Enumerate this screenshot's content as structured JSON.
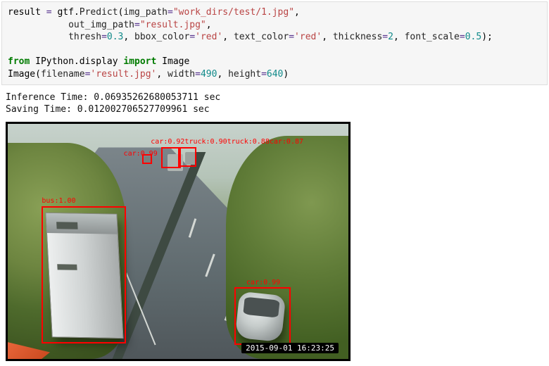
{
  "code": {
    "result_var": "result",
    "gtf": "gtf",
    "predict": "Predict",
    "img_path_key": "img_path",
    "img_path_val": "\"work_dirs/test/1.jpg\"",
    "out_img_path_key": "out_img_path",
    "out_img_path_val": "\"result.jpg\"",
    "thresh_key": "thresh",
    "thresh_val": "0.3",
    "bbox_color_key": "bbox_color",
    "bbox_color_val": "'red'",
    "text_color_key": "text_color",
    "text_color_val": "'red'",
    "thickness_key": "thickness",
    "thickness_val": "2",
    "font_scale_key": "font_scale",
    "font_scale_val": "0.5",
    "from_kw": "from",
    "import_kw": "import",
    "ipython_display": "IPython.display",
    "image_cls": "Image",
    "filename_key": "filename",
    "filename_val": "'result.jpg'",
    "width_key": "width",
    "width_val": "490",
    "height_key": "height",
    "height_val": "640"
  },
  "output": {
    "inference_line": "Inference Time: 0.06935262680053711 sec",
    "saving_line": "Saving Time: 0.012002706527709961 sec"
  },
  "detections": {
    "bus_label": "bus:1.00",
    "car_label_far": "car:0.99",
    "car_label_near": "car:0.99",
    "cluster_label": "car:0.92truck:0.90truck:0.88car:0.87"
  },
  "timestamp": "2015-09-01 16:23:25"
}
